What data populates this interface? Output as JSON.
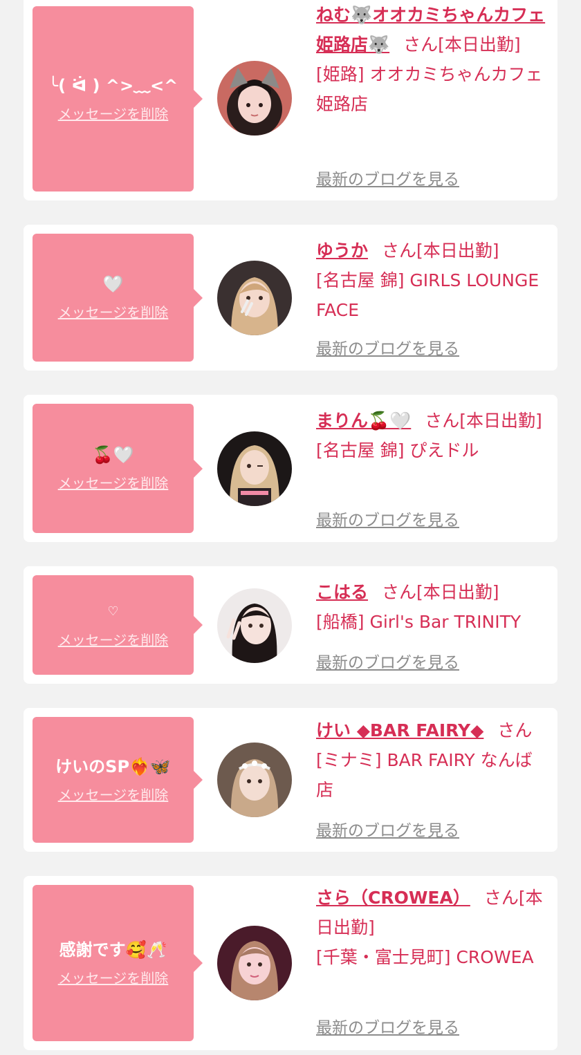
{
  "delete_label": "メッセージを削除",
  "blog_label": "最新のブログを見る",
  "colors": {
    "bubble": "#f68d9d",
    "name": "#d62e55",
    "blog": "#8c8c8c",
    "background": "#f2f2f2"
  },
  "items": [
    {
      "message": "╰( ᐛ ) ^>﹏<^",
      "name": "ねむ🐺オオカミちゃんカフェ姫路店🐺",
      "san": "さん",
      "status": "[本日出勤]",
      "shop": "[姫路] オオカミちゃんカフェ姫路店",
      "avatar_icon": "wolf-ears-girl"
    },
    {
      "message": "🤍",
      "name": "ゆうか",
      "san": "さん",
      "status": "[本日出勤]",
      "shop": "[名古屋 錦] GIRLS LOUNGE FACE",
      "avatar_icon": "blonde-girl-peace"
    },
    {
      "message": "🍒🤍",
      "name": "まりん🍒🤍",
      "san": "さん",
      "status": "[本日出勤]",
      "shop": "[名古屋 錦] ぴえドル",
      "avatar_icon": "blonde-girl-wink"
    },
    {
      "message": "♡",
      "name": "こはる",
      "san": "さん",
      "status": "[本日出勤]",
      "shop": "[船橋] Girl's Bar TRINITY",
      "avatar_icon": "dark-hair-girl-peace"
    },
    {
      "message": "けいのSP❤️‍🔥🦋",
      "name": "けい ◆BAR FAIRY◆",
      "san": "さん",
      "status": "",
      "shop": "[ミナミ] BAR FAIRY なんば店",
      "avatar_icon": "star-headband-girl"
    },
    {
      "message": "感謝です🥰🥂",
      "name": "さら（CROWEA）",
      "san": "さん",
      "status": "[本日出勤]",
      "shop": "[千葉・富士見町] CROWEA",
      "avatar_icon": "pink-light-girl"
    }
  ]
}
